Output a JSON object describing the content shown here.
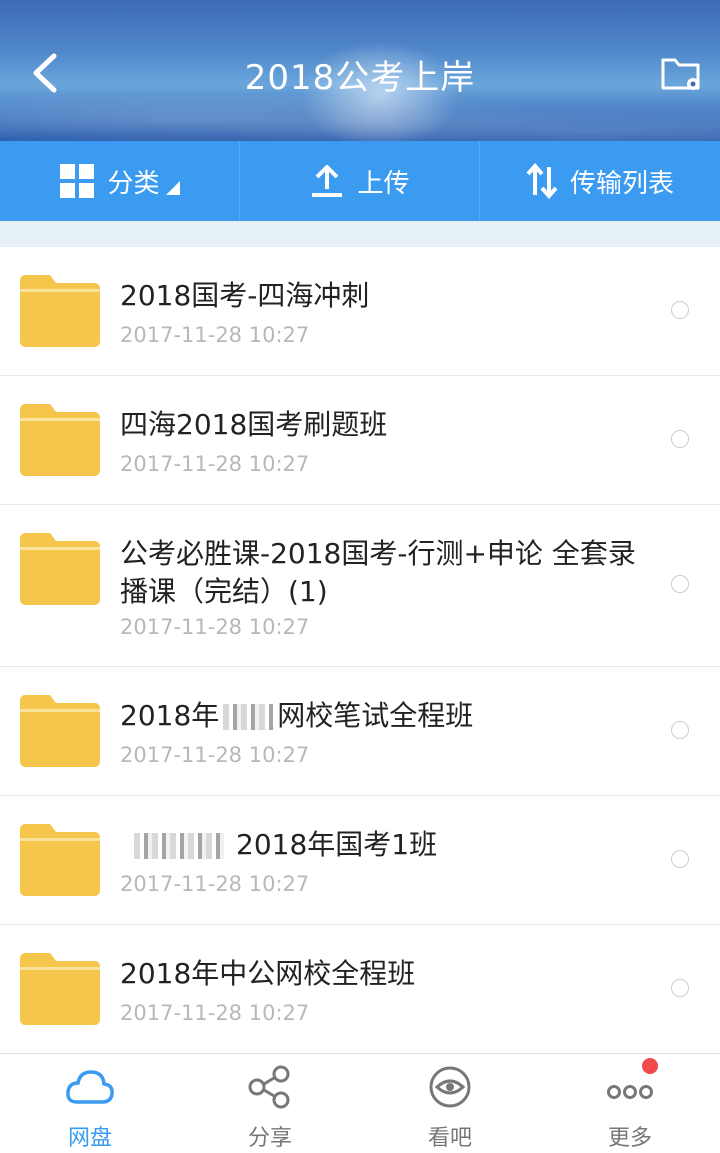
{
  "header": {
    "title": "2018公考上岸",
    "back_icon": "chevron-left-icon",
    "settings_icon": "folder-settings-icon"
  },
  "toolbar": {
    "category_label": "分类",
    "upload_label": "上传",
    "transfer_label": "传输列表"
  },
  "files": [
    {
      "name": "2018国考-四海冲刺",
      "date": "2017-11-28  10:27"
    },
    {
      "name": "四海2018国考刷题班",
      "date": "2017-11-28  10:27"
    },
    {
      "name": "公考必胜课-2018国考-行测+申论 全套录播课（完结）(1)",
      "date": "2017-11-28  10:27"
    },
    {
      "name_prefix": "2018年",
      "name_suffix": "网校笔试全程班",
      "date": "2017-11-28  10:27"
    },
    {
      "name_suffix": "2018年国考1班",
      "date": "2017-11-28  10:27"
    },
    {
      "name": "2018年中公网校全程班",
      "date": "2017-11-28  10:27"
    }
  ],
  "bottom_nav": [
    {
      "label": "网盘",
      "icon": "cloud-icon",
      "active": true
    },
    {
      "label": "分享",
      "icon": "share-icon",
      "active": false
    },
    {
      "label": "看吧",
      "icon": "eye-icon",
      "active": false
    },
    {
      "label": "更多",
      "icon": "more-icon",
      "active": false,
      "badge": true
    }
  ],
  "colors": {
    "accent": "#3a9bf1",
    "folder": "#f5c64b",
    "badge": "#f04a4a"
  }
}
